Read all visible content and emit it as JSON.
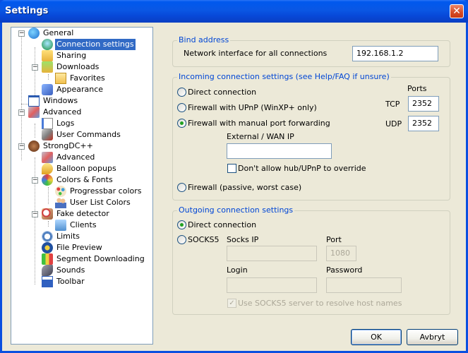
{
  "window": {
    "title": "Settings",
    "close_glyph": "✕"
  },
  "tree": [
    {
      "label": "General",
      "icon": "globe-icon"
    },
    {
      "label": "Connection settings",
      "icon": "network-icon",
      "selected": true
    },
    {
      "label": "Sharing",
      "icon": "sharing-folder-icon"
    },
    {
      "label": "Downloads",
      "icon": "downloads-folder-icon"
    },
    {
      "label": "Favorites",
      "icon": "folder-icon"
    },
    {
      "label": "Appearance",
      "icon": "appearance-icon"
    },
    {
      "label": "Windows",
      "icon": "window-icon"
    },
    {
      "label": "Advanced",
      "icon": "advanced-icon"
    },
    {
      "label": "Logs",
      "icon": "logs-icon"
    },
    {
      "label": "User Commands",
      "icon": "wrench-icon"
    },
    {
      "label": "StrongDC++",
      "icon": "strongdc-icon"
    },
    {
      "label": "Advanced",
      "icon": "advanced-icon"
    },
    {
      "label": "Balloon popups",
      "icon": "balloon-icon"
    },
    {
      "label": "Colors & Fonts",
      "icon": "colors-icon"
    },
    {
      "label": "Progressbar colors",
      "icon": "palette-icon"
    },
    {
      "label": "User List Colors",
      "icon": "users-icon"
    },
    {
      "label": "Fake detector",
      "icon": "detector-icon"
    },
    {
      "label": "Clients",
      "icon": "clients-icon"
    },
    {
      "label": "Limits",
      "icon": "limits-icon"
    },
    {
      "label": "File Preview",
      "icon": "preview-icon"
    },
    {
      "label": "Segment Downloading",
      "icon": "segment-icon"
    },
    {
      "label": "Sounds",
      "icon": "sounds-icon"
    },
    {
      "label": "Toolbar",
      "icon": "toolbar-icon"
    }
  ],
  "bind": {
    "legend": "Bind address",
    "label": "Network interface for all connections",
    "value": "192.168.1.2"
  },
  "incoming": {
    "legend": "Incoming connection settings (see Help/FAQ if unsure)",
    "ports_header": "Ports",
    "direct": "Direct connection",
    "upnp": "Firewall with UPnP (WinXP+ only)",
    "manual": "Firewall with manual port forwarding",
    "passive": "Firewall (passive, worst case)",
    "tcp_label": "TCP",
    "tcp_value": "2352",
    "udp_label": "UDP",
    "udp_value": "2352",
    "wan_label": "External / WAN IP",
    "wan_value": "",
    "override_label": "Don't allow hub/UPnP to override"
  },
  "outgoing": {
    "legend": "Outgoing connection settings",
    "direct": "Direct connection",
    "socks5": "SOCKS5",
    "socks_ip_label": "Socks IP",
    "port_label": "Port",
    "port_value": "1080",
    "login_label": "Login",
    "password_label": "Password",
    "resolve_label": "Use SOCKS5 server to resolve host names"
  },
  "buttons": {
    "ok": "OK",
    "cancel": "Avbryt"
  }
}
